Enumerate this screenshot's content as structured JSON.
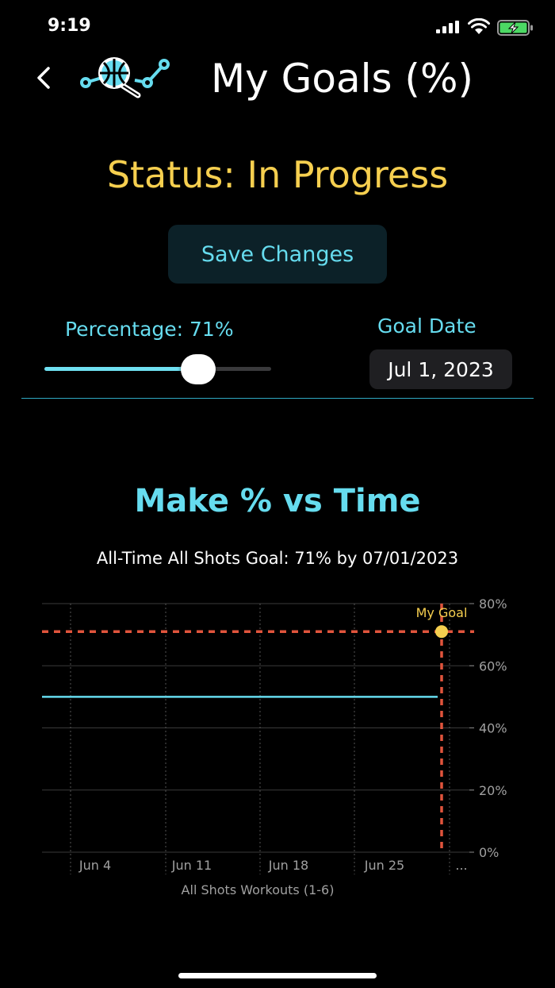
{
  "status_bar": {
    "time": "9:19"
  },
  "header": {
    "back_icon": "chevron-left-icon",
    "logo_icon": "basketball-magnifier-trend-icon",
    "title": "My Goals (%)"
  },
  "status": {
    "label": "Status: In Progress",
    "color": "#f6cf4f"
  },
  "save_button": {
    "label": "Save Changes"
  },
  "percentage": {
    "label": "Percentage: 71%",
    "value": 71,
    "min": 0,
    "max": 100
  },
  "goal_date": {
    "label": "Goal Date",
    "value": "Jul 1, 2023"
  },
  "colors": {
    "accent": "#66dcef",
    "goal_line": "#e0543c",
    "goal_marker": "#f6cf4f"
  },
  "chart_data": {
    "type": "line",
    "title": "Make % vs Time",
    "subtitle": "All-Time All Shots Goal: 71% by 07/01/2023",
    "xlabel": "All Shots Workouts (1-6)",
    "x_tick_labels": [
      "Jun 4",
      "Jun 11",
      "Jun 18",
      "Jun 25",
      "..."
    ],
    "y_tick_labels": [
      "0%",
      "20%",
      "40%",
      "60%",
      "80%"
    ],
    "ylim": [
      0,
      80
    ],
    "grid": true,
    "series": [
      {
        "values": [
          50,
          50
        ],
        "color": "#66dcef"
      }
    ],
    "goal": {
      "label": "My Goal",
      "value": 71,
      "date": "07/01/2023"
    }
  }
}
